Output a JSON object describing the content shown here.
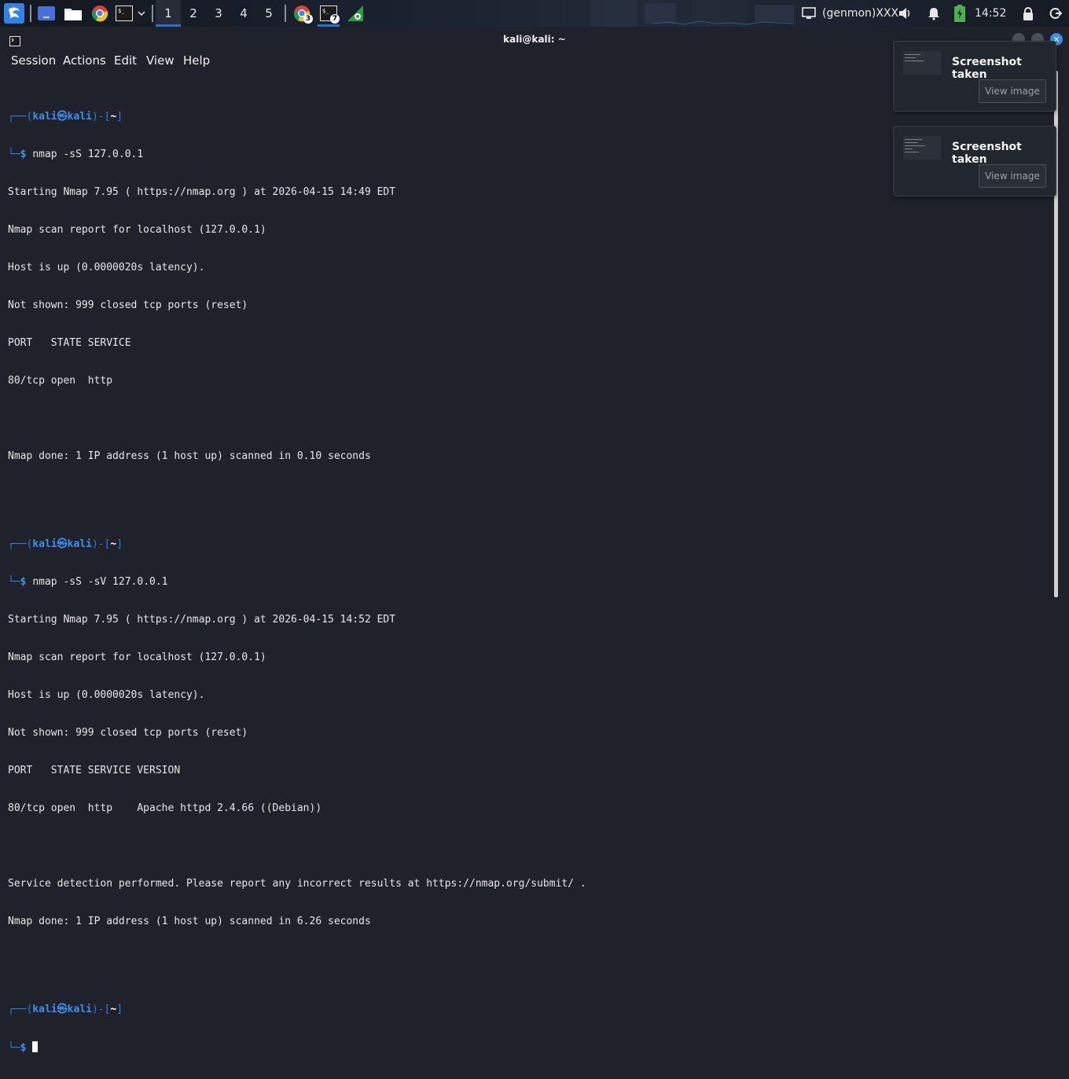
{
  "panel": {
    "workspaces": [
      "1",
      "2",
      "3",
      "4",
      "5"
    ],
    "active_workspace": "1",
    "chrome_badge": "3",
    "terminal_badge": "7",
    "genmon_text": "(genmon)XXX",
    "clock": "14:52",
    "launcher_icons": [
      "kali-menu-icon",
      "workspace-switcher-icon",
      "file-manager-icon",
      "chrome-icon",
      "terminal-icon",
      "chevron-down-icon"
    ]
  },
  "window": {
    "title": "kali@kali: ~"
  },
  "menubar": {
    "items": [
      "Session",
      "Actions",
      "Edit",
      "View",
      "Help"
    ]
  },
  "terminal": {
    "prompt": {
      "top_open": "┌──(",
      "user_host": "kali㉿kali",
      "mid": ")-[",
      "dir": "~",
      "close": "]",
      "bottom": "└─",
      "dollar": "$"
    },
    "command1": "nmap -sS 127.0.0.1",
    "out1": [
      "Starting Nmap 7.95 ( https://nmap.org ) at 2026-04-15 14:49 EDT",
      "Nmap scan report for localhost (127.0.0.1)",
      "Host is up (0.0000020s latency).",
      "Not shown: 999 closed tcp ports (reset)",
      "PORT   STATE SERVICE",
      "80/tcp open  http",
      "",
      "Nmap done: 1 IP address (1 host up) scanned in 0.10 seconds",
      ""
    ],
    "command2": "nmap -sS -sV 127.0.0.1",
    "out2": [
      "Starting Nmap 7.95 ( https://nmap.org ) at 2026-04-15 14:52 EDT",
      "Nmap scan report for localhost (127.0.0.1)",
      "Host is up (0.0000020s latency).",
      "Not shown: 999 closed tcp ports (reset)",
      "PORT   STATE SERVICE VERSION",
      "80/tcp open  http    Apache httpd 2.4.66 ((Debian))",
      "",
      "Service detection performed. Please report any incorrect results at https://nmap.org/submit/ .",
      "Nmap done: 1 IP address (1 host up) scanned in 6.26 seconds",
      ""
    ]
  },
  "notifications": [
    {
      "title": "Screenshot taken",
      "button": "View image"
    },
    {
      "title": "Screenshot taken",
      "button": "View image"
    }
  ],
  "colors": {
    "accent": "#2a6fd6",
    "prompt_blue": "#2f7be0",
    "terminal_bg": "#1f222b"
  }
}
